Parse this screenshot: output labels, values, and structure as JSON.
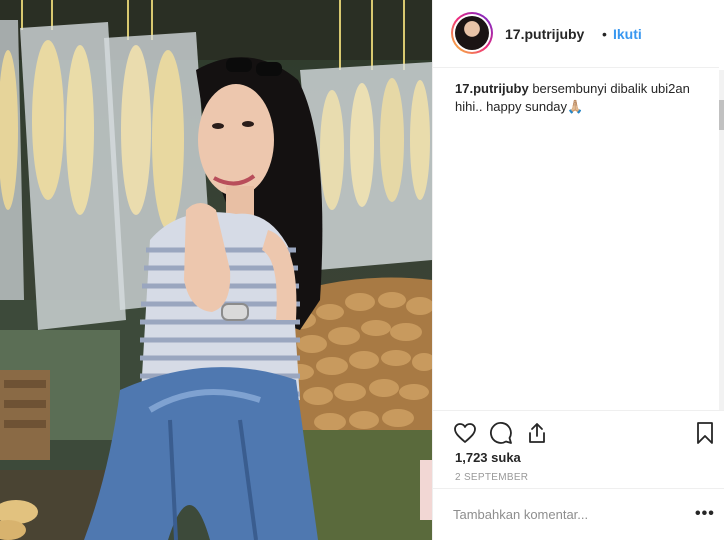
{
  "post": {
    "photo": {
      "icon": "photo-woman-with-cassava"
    },
    "header": {
      "username": "17.putrijuby",
      "separator": "•",
      "follow_label": "Ikuti"
    },
    "caption": {
      "username": "17.putrijuby",
      "text": "bersembunyi dibalik ubi2an hihi.. happy sunday🙏🏼"
    },
    "actions": {
      "like_icon": "heart-icon",
      "comment_icon": "comment-icon",
      "share_icon": "share-icon",
      "save_icon": "bookmark-icon"
    },
    "likes": "1,723 suka",
    "date": "2 SEPTEMBER",
    "comment": {
      "placeholder": "Tambahkan komentar...",
      "more_label": "•••"
    },
    "colors": {
      "link": "#3897f0",
      "text": "#262626",
      "muted": "#999999",
      "border": "#efefef"
    }
  }
}
